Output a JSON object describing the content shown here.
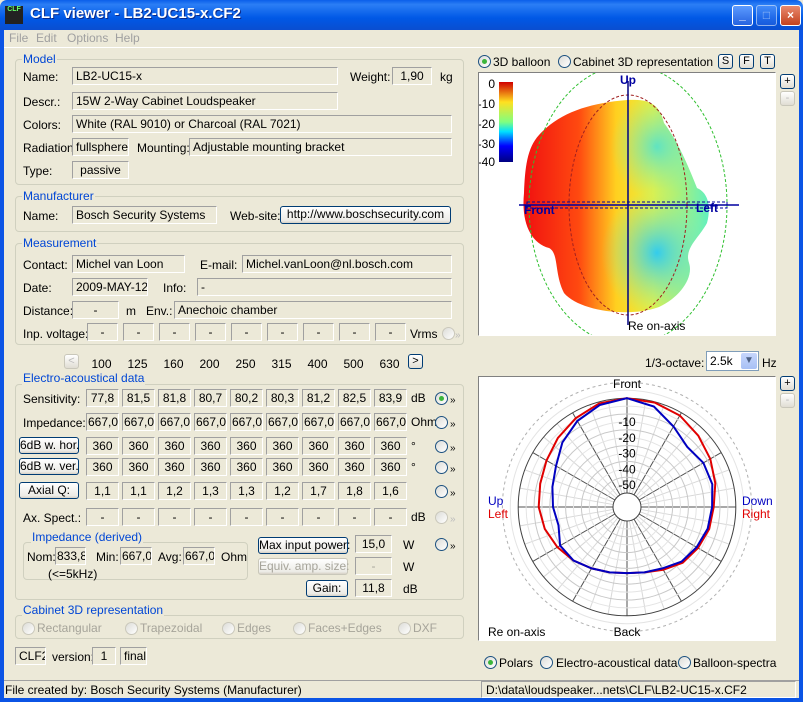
{
  "window": {
    "title": "CLF viewer - LB2-UC15-x.CF2",
    "icon_text": "CLF",
    "minimize": "_",
    "maximize": "□",
    "close": "×"
  },
  "menu": [
    "File",
    "Edit",
    "Options",
    "Help"
  ],
  "model": {
    "legend": "Model",
    "name_label": "Name:",
    "name": "LB2-UC15-x",
    "weight_label": "Weight:",
    "weight": "1,90",
    "weight_unit": "kg",
    "descr_label": "Descr.:",
    "descr": "15W 2-Way Cabinet Loudspeaker",
    "colors_label": "Colors:",
    "colors": "White (RAL 9010) or Charcoal (RAL 7021)",
    "radiation_label": "Radiation:",
    "radiation": "fullsphere",
    "mounting_label": "Mounting:",
    "mounting": "Adjustable mounting bracket",
    "type_label": "Type:",
    "type": "passive"
  },
  "manufacturer": {
    "legend": "Manufacturer",
    "name_label": "Name:",
    "name": "Bosch Security Systems",
    "website_label": "Web-site:",
    "website": "http://www.boschsecurity.com"
  },
  "measurement": {
    "legend": "Measurement",
    "contact_label": "Contact:",
    "contact": "Michel van Loon",
    "email_label": "E-mail:",
    "email": "Michel.vanLoon@nl.bosch.com",
    "date_label": "Date:",
    "date": "2009-MAY-12",
    "info_label": "Info:",
    "info": "-",
    "distance_label": "Distance:",
    "distance": "-",
    "distance_unit": "m",
    "env_label": "Env.:",
    "env": "Anechoic chamber",
    "voltage_label": "Inp. voltage:",
    "voltage": [
      "-",
      "-",
      "-",
      "-",
      "-",
      "-",
      "-",
      "-",
      "-"
    ],
    "voltage_unit": "Vrms"
  },
  "frequencies": {
    "prev": "<",
    "next": ">",
    "values": [
      "100",
      "125",
      "160",
      "200",
      "250",
      "315",
      "400",
      "500",
      "630"
    ]
  },
  "electro": {
    "legend": "Electro-acoustical data",
    "rows": [
      {
        "label": "Sensitivity:",
        "button": false,
        "values": [
          "77,8",
          "81,5",
          "81,8",
          "80,7",
          "80,2",
          "80,3",
          "81,2",
          "82,5",
          "83,9"
        ],
        "unit": "dB",
        "selected": true,
        "enabled": true
      },
      {
        "label": "Impedance:",
        "button": false,
        "values": [
          "667,0",
          "667,0",
          "667,0",
          "667,0",
          "667,0",
          "667,0",
          "667,0",
          "667,0",
          "667,0"
        ],
        "unit": "Ohm",
        "selected": false,
        "enabled": true
      },
      {
        "label": "6dB w. hor.",
        "button": true,
        "values": [
          "360",
          "360",
          "360",
          "360",
          "360",
          "360",
          "360",
          "360",
          "360"
        ],
        "unit": "°",
        "selected": false,
        "enabled": true
      },
      {
        "label": "6dB w. ver.",
        "button": true,
        "values": [
          "360",
          "360",
          "360",
          "360",
          "360",
          "360",
          "360",
          "360",
          "360"
        ],
        "unit": "°",
        "selected": false,
        "enabled": true
      },
      {
        "label": "Axial Q:",
        "button": true,
        "values": [
          "1,1",
          "1,1",
          "1,2",
          "1,3",
          "1,3",
          "1,2",
          "1,7",
          "1,8",
          "1,6"
        ],
        "unit": "",
        "selected": false,
        "enabled": true
      },
      {
        "label": "Ax. Spect.:",
        "button": false,
        "values": [
          "-",
          "-",
          "-",
          "-",
          "-",
          "-",
          "-",
          "-",
          "-"
        ],
        "unit": "dB",
        "selected": false,
        "enabled": false
      }
    ],
    "more": "»",
    "impedance_derived": {
      "legend": "Impedance (derived)",
      "nom_label": "Nom:",
      "nom": "833,8",
      "nom_note": "(<=5kHz)",
      "min_label": "Min:",
      "min": "667,0",
      "avg_label": "Avg:",
      "avg": "667,0",
      "unit": "Ohm"
    },
    "max_power_label": "Max input power:",
    "max_power": "15,0",
    "max_power_unit": "W",
    "equiv_label": "Equiv. amp. size:",
    "equiv": "-",
    "equiv_unit": "W",
    "gain_label": "Gain:",
    "gain": "11,8",
    "gain_unit": "dB"
  },
  "cabinet": {
    "legend": "Cabinet 3D representation",
    "options": [
      "Rectangular",
      "Trapezoidal",
      "Edges",
      "Faces+Edges",
      "DXF"
    ]
  },
  "format": {
    "name": "CLF2",
    "version_label": "version:",
    "version": "1",
    "status": "final"
  },
  "balloon": {
    "mode_options": [
      "3D balloon",
      "Cabinet 3D representation"
    ],
    "selected": "3D balloon",
    "view_buttons": [
      "S",
      "F",
      "T"
    ],
    "zoom_in": "+",
    "zoom_out": "-",
    "scale_labels": [
      "0",
      "-10",
      "-20",
      "-30",
      "-40"
    ],
    "label_up": "Up",
    "label_front": "Front",
    "label_left": "Left",
    "label_ref": "Re on-axis"
  },
  "octave": {
    "label": "1/3-octave:",
    "value": "2.5k",
    "unit": "Hz"
  },
  "chart_data": {
    "type": "polar",
    "angle_labels": {
      "top": "Front",
      "bottom": "Back"
    },
    "left_labels": [
      "Up",
      "Left"
    ],
    "right_labels": [
      "Down",
      "Right"
    ],
    "ref_label": "Re on-axis",
    "ring_labels": [
      "-10",
      "-20",
      "-30",
      "-40",
      "-50"
    ],
    "rlim": [
      -60,
      10
    ],
    "angles_deg": [
      0,
      15,
      30,
      45,
      60,
      75,
      90,
      105,
      120,
      135,
      150,
      165,
      180,
      195,
      210,
      225,
      240,
      255,
      270,
      285,
      300,
      315,
      330,
      345
    ],
    "series": [
      {
        "name": "Left/Right",
        "color": "#E00000",
        "values": [
          0,
          -0.5,
          -2,
          -5,
          -8,
          -11,
          -14,
          -15,
          -17,
          -19,
          -23,
          -26,
          -27,
          -26,
          -24,
          -21,
          -18,
          -15,
          -13,
          -12,
          -10,
          -7,
          -4,
          -1
        ]
      },
      {
        "name": "Up/Down",
        "color": "#0000C0",
        "values": [
          0,
          -3,
          -10,
          -15,
          -13,
          -13,
          -15,
          -16,
          -18,
          -20,
          -24,
          -26,
          -27,
          -26,
          -24,
          -21,
          -20,
          -24,
          -22,
          -20,
          -17,
          -11,
          -6,
          -2
        ]
      }
    ]
  },
  "view_options": {
    "options": [
      "Polars",
      "Electro-acoustical data",
      "Balloon-spectra"
    ],
    "selected": "Polars"
  },
  "status": {
    "left": "File created by: Bosch Security Systems (Manufacturer)",
    "right": "D:\\data\\loudspeaker...nets\\CLF\\LB2-UC15-x.CF2"
  },
  "colors": {
    "title_bar": "#0058E6",
    "accent": "#0046D5",
    "red_series": "#E00000",
    "blue_series": "#0000C0"
  }
}
